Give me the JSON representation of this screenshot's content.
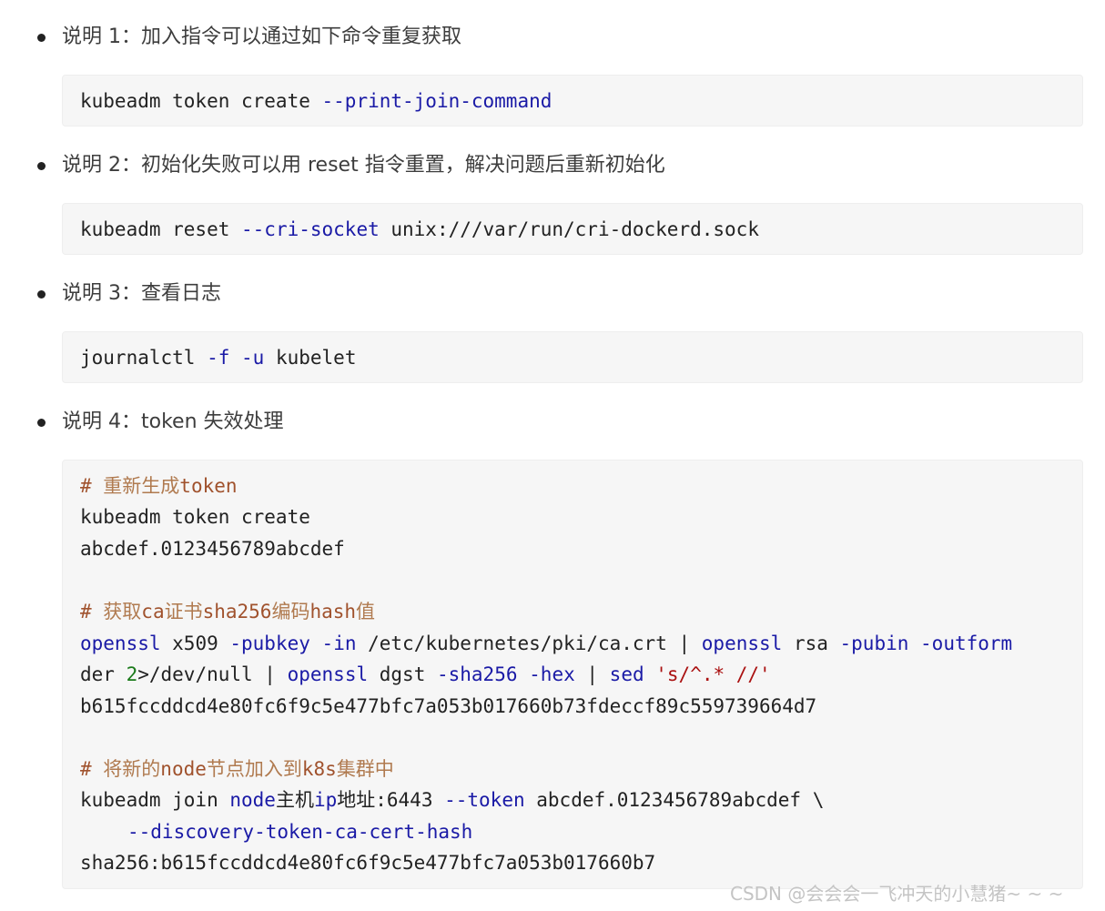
{
  "notes": [
    "说明 1：加入指令可以通过如下命令重复获取",
    "说明 2：初始化失败可以用 reset 指令重置，解决问题后重新初始化",
    "说明 3：查看日志",
    "说明 4：token 失效处理"
  ],
  "code1": {
    "a": "kubeadm token create ",
    "b": "--print-join-command"
  },
  "code2": {
    "a": "kubeadm reset ",
    "b": "--cri-socket",
    "c": " unix:///var/run/cri-dockerd.sock"
  },
  "code3": {
    "a": "journalctl ",
    "b": "-f",
    "c": " ",
    "d": "-u",
    "e": " kubelet"
  },
  "code4": {
    "l1_hash": "# ",
    "l1_cn1": "重新生成",
    "l1_en": "token",
    "l2": "kubeadm token create",
    "l3": "abcdef.0123456789abcdef",
    "l5_hash": "# ",
    "l5_cn1": "获取",
    "l5_en1": "ca",
    "l5_cn2": "证书",
    "l5_en2": "sha256",
    "l5_cn3": "编码",
    "l5_en3": "hash",
    "l5_cn4": "值",
    "l6_a": "openssl",
    "l6_b": " x509 ",
    "l6_c": "-pubkey",
    "l6_d": " ",
    "l6_e": "-in",
    "l6_f": " /etc/kubernetes/pki/ca.crt | ",
    "l6_g": "openssl",
    "l6_h": " rsa ",
    "l6_i": "-pubin",
    "l6_j": " ",
    "l6_k": "-outform",
    "l7_a": "der ",
    "l7_b": "2",
    "l7_c": ">/dev/null | ",
    "l7_d": "openssl",
    "l7_e": " dgst ",
    "l7_f": "-sha256",
    "l7_g": " ",
    "l7_h": "-hex",
    "l7_i": " | ",
    "l7_j": "sed",
    "l7_k": " ",
    "l7_l": "'s/^.* //'",
    "l8": "b615fccddcd4e80fc6f9c5e477bfc7a053b017660b73fdeccf89c559739664d7",
    "l10_hash": "# ",
    "l10_cn1": "将新的",
    "l10_en1": "node",
    "l10_cn2": "节点加入到",
    "l10_en2": "k8s",
    "l10_cn3": "集群中",
    "l11_a": "kubeadm join ",
    "l11_b": "node",
    "l11_c": "主机",
    "l11_d": "ip",
    "l11_e": "地址",
    "l11_f": ":6443 ",
    "l11_g": "--token",
    "l11_h": " abcdef.0123456789abcdef \\",
    "l12": "--discovery-token-ca-cert-hash",
    "l13": "sha256:b615fccddcd4e80fc6f9c5e477bfc7a053b017660b7"
  },
  "watermark": "CSDN @会会会一飞冲天的小慧猪~ ~ ~"
}
